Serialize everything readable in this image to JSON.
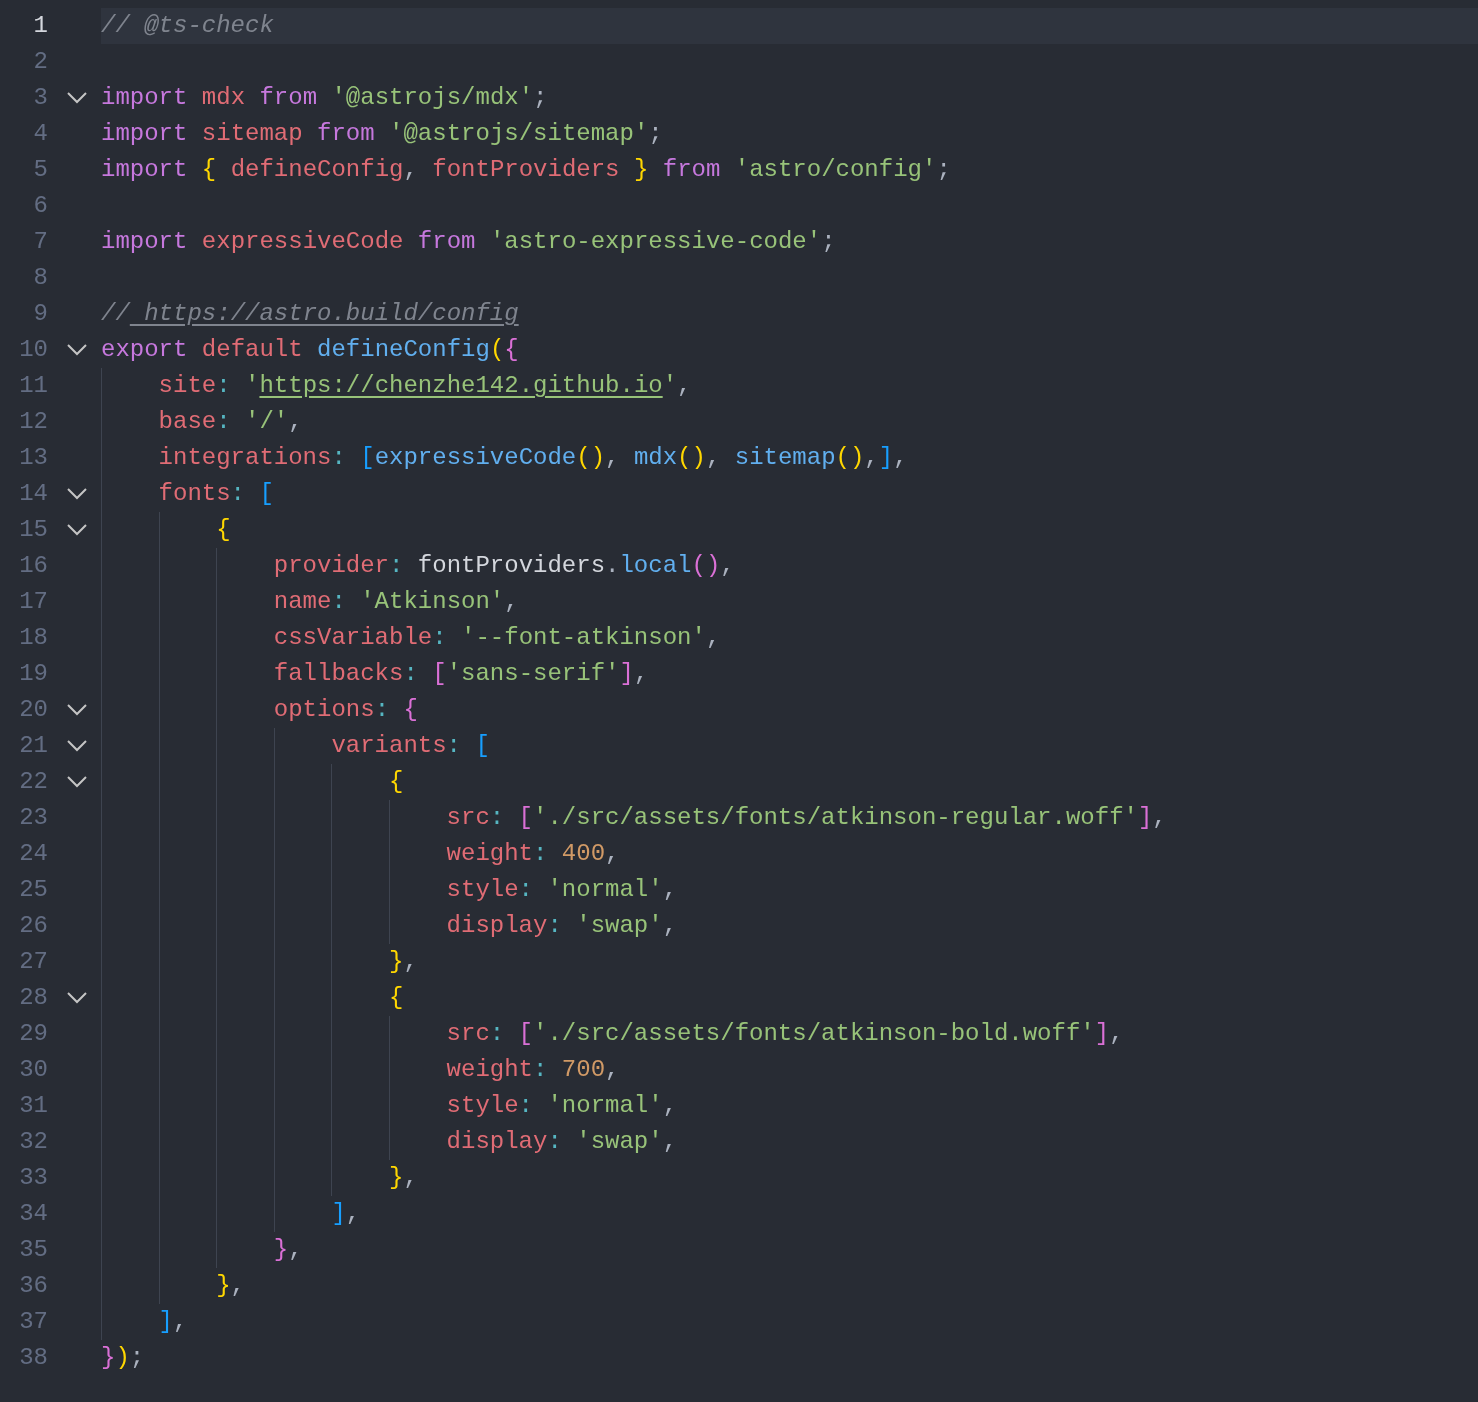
{
  "editor": {
    "lines": [
      {
        "number": "1",
        "active": true,
        "foldable": false,
        "tokens": [
          {
            "text": "// @ts-check",
            "kind": "comment"
          }
        ]
      },
      {
        "number": "2",
        "active": false,
        "foldable": false
      },
      {
        "number": "3",
        "active": false,
        "foldable": true,
        "tokens": [
          {
            "text": "import",
            "kind": "keyword"
          },
          {
            "text": " mdx",
            "kind": "variable"
          },
          {
            "text": " from",
            "kind": "keyword"
          },
          {
            "text": " '@astrojs/mdx'",
            "kind": "string"
          },
          {
            "text": ";",
            "kind": "punct"
          }
        ]
      },
      {
        "number": "4",
        "active": false,
        "foldable": false,
        "tokens": [
          {
            "text": "import",
            "kind": "keyword"
          },
          {
            "text": " sitemap",
            "kind": "variable"
          },
          {
            "text": " from",
            "kind": "keyword"
          },
          {
            "text": " '@astrojs/sitemap'",
            "kind": "string"
          },
          {
            "text": ";",
            "kind": "punct"
          }
        ]
      },
      {
        "number": "5",
        "active": false,
        "foldable": false,
        "tokens": [
          {
            "text": "import",
            "kind": "keyword"
          },
          {
            "text": " {",
            "kind": "brace1"
          },
          {
            "text": " defineConfig",
            "kind": "variable"
          },
          {
            "text": ",",
            "kind": "punct"
          },
          {
            "text": " fontProviders",
            "kind": "variable"
          },
          {
            "text": " }",
            "kind": "brace1"
          },
          {
            "text": " from",
            "kind": "keyword"
          },
          {
            "text": " 'astro/config'",
            "kind": "string"
          },
          {
            "text": ";",
            "kind": "punct"
          }
        ]
      },
      {
        "number": "6",
        "active": false,
        "foldable": false
      },
      {
        "number": "7",
        "active": false,
        "foldable": false,
        "tokens": [
          {
            "text": "import",
            "kind": "keyword"
          },
          {
            "text": " expressiveCode",
            "kind": "variable"
          },
          {
            "text": " from",
            "kind": "keyword"
          },
          {
            "text": " 'astro-expressive-code'",
            "kind": "string"
          },
          {
            "text": ";",
            "kind": "punct"
          }
        ]
      },
      {
        "number": "8",
        "active": false,
        "foldable": false
      },
      {
        "number": "9",
        "active": false,
        "foldable": false,
        "tokens": [
          {
            "text": "//",
            "kind": "comment"
          },
          {
            "text": " https://astro.build/config",
            "kind": "comment-link"
          }
        ]
      },
      {
        "number": "10",
        "active": false,
        "foldable": true,
        "tokens": [
          {
            "text": "export",
            "kind": "keyword"
          },
          {
            "text": " default",
            "kind": "variable"
          },
          {
            "text": " defineConfig",
            "kind": "function"
          },
          {
            "text": "(",
            "kind": "brace1"
          },
          {
            "text": "{",
            "kind": "brace2"
          }
        ],
        "children": [
          {
            "number": "11",
            "active": false,
            "foldable": false,
            "tokens": [
              {
                "text": "site",
                "kind": "variable"
              },
              {
                "text": ":",
                "kind": "colon"
              },
              {
                "text": " '",
                "kind": "string"
              },
              {
                "text": "https://chenzhe142.github.io",
                "kind": "string-link"
              },
              {
                "text": "'",
                "kind": "string"
              },
              {
                "text": ",",
                "kind": "punct"
              }
            ]
          },
          {
            "number": "12",
            "active": false,
            "foldable": false,
            "tokens": [
              {
                "text": "base",
                "kind": "variable"
              },
              {
                "text": ":",
                "kind": "colon"
              },
              {
                "text": " '/'",
                "kind": "string"
              },
              {
                "text": ",",
                "kind": "punct"
              }
            ]
          },
          {
            "number": "13",
            "active": false,
            "foldable": false,
            "tokens": [
              {
                "text": "integrations",
                "kind": "variable"
              },
              {
                "text": ":",
                "kind": "colon"
              },
              {
                "text": " [",
                "kind": "brace3"
              },
              {
                "text": "expressiveCode",
                "kind": "function"
              },
              {
                "text": "()",
                "kind": "brace1"
              },
              {
                "text": ",",
                "kind": "punct"
              },
              {
                "text": " mdx",
                "kind": "function"
              },
              {
                "text": "()",
                "kind": "brace1"
              },
              {
                "text": ",",
                "kind": "punct"
              },
              {
                "text": " sitemap",
                "kind": "function"
              },
              {
                "text": "()",
                "kind": "brace1"
              },
              {
                "text": ",",
                "kind": "punct"
              },
              {
                "text": "]",
                "kind": "brace3"
              },
              {
                "text": ",",
                "kind": "punct"
              }
            ]
          },
          {
            "number": "14",
            "active": false,
            "foldable": true,
            "tokens": [
              {
                "text": "fonts",
                "kind": "variable"
              },
              {
                "text": ":",
                "kind": "colon"
              },
              {
                "text": " [",
                "kind": "brace3"
              }
            ],
            "children": [
              {
                "number": "15",
                "active": false,
                "foldable": true,
                "tokens": [
                  {
                    "text": "{",
                    "kind": "brace1"
                  }
                ],
                "children": [
                  {
                    "number": "16",
                    "active": false,
                    "foldable": false,
                    "tokens": [
                      {
                        "text": "provider",
                        "kind": "variable"
                      },
                      {
                        "text": ":",
                        "kind": "colon"
                      },
                      {
                        "text": " fontProviders",
                        "kind": "plain"
                      },
                      {
                        "text": ".",
                        "kind": "punct"
                      },
                      {
                        "text": "local",
                        "kind": "function"
                      },
                      {
                        "text": "()",
                        "kind": "brace2"
                      },
                      {
                        "text": ",",
                        "kind": "punct"
                      }
                    ]
                  },
                  {
                    "number": "17",
                    "active": false,
                    "foldable": false,
                    "tokens": [
                      {
                        "text": "name",
                        "kind": "variable"
                      },
                      {
                        "text": ":",
                        "kind": "colon"
                      },
                      {
                        "text": " 'Atkinson'",
                        "kind": "string"
                      },
                      {
                        "text": ",",
                        "kind": "punct"
                      }
                    ]
                  },
                  {
                    "number": "18",
                    "active": false,
                    "foldable": false,
                    "tokens": [
                      {
                        "text": "cssVariable",
                        "kind": "variable"
                      },
                      {
                        "text": ":",
                        "kind": "colon"
                      },
                      {
                        "text": " '--font-atkinson'",
                        "kind": "string"
                      },
                      {
                        "text": ",",
                        "kind": "punct"
                      }
                    ]
                  },
                  {
                    "number": "19",
                    "active": false,
                    "foldable": false,
                    "tokens": [
                      {
                        "text": "fallbacks",
                        "kind": "variable"
                      },
                      {
                        "text": ":",
                        "kind": "colon"
                      },
                      {
                        "text": " [",
                        "kind": "brace2"
                      },
                      {
                        "text": "'sans-serif'",
                        "kind": "string"
                      },
                      {
                        "text": "]",
                        "kind": "brace2"
                      },
                      {
                        "text": ",",
                        "kind": "punct"
                      }
                    ]
                  },
                  {
                    "number": "20",
                    "active": false,
                    "foldable": true,
                    "tokens": [
                      {
                        "text": "options",
                        "kind": "variable"
                      },
                      {
                        "text": ":",
                        "kind": "colon"
                      },
                      {
                        "text": " {",
                        "kind": "brace2"
                      }
                    ],
                    "children": [
                      {
                        "number": "21",
                        "active": false,
                        "foldable": true,
                        "tokens": [
                          {
                            "text": "variants",
                            "kind": "variable"
                          },
                          {
                            "text": ":",
                            "kind": "colon"
                          },
                          {
                            "text": " [",
                            "kind": "brace3"
                          }
                        ],
                        "children": [
                          {
                            "number": "22",
                            "active": false,
                            "foldable": true,
                            "tokens": [
                              {
                                "text": "{",
                                "kind": "brace1"
                              }
                            ],
                            "children": [
                              {
                                "number": "23",
                                "active": false,
                                "foldable": false,
                                "tokens": [
                                  {
                                    "text": "src",
                                    "kind": "variable"
                                  },
                                  {
                                    "text": ":",
                                    "kind": "colon"
                                  },
                                  {
                                    "text": " [",
                                    "kind": "brace2"
                                  },
                                  {
                                    "text": "'./src/assets/fonts/atkinson-regular.woff'",
                                    "kind": "string"
                                  },
                                  {
                                    "text": "]",
                                    "kind": "brace2"
                                  },
                                  {
                                    "text": ",",
                                    "kind": "punct"
                                  }
                                ]
                              },
                              {
                                "number": "24",
                                "active": false,
                                "foldable": false,
                                "tokens": [
                                  {
                                    "text": "weight",
                                    "kind": "variable"
                                  },
                                  {
                                    "text": ":",
                                    "kind": "colon"
                                  },
                                  {
                                    "text": " 400",
                                    "kind": "number"
                                  },
                                  {
                                    "text": ",",
                                    "kind": "punct"
                                  }
                                ]
                              },
                              {
                                "number": "25",
                                "active": false,
                                "foldable": false,
                                "tokens": [
                                  {
                                    "text": "style",
                                    "kind": "variable"
                                  },
                                  {
                                    "text": ":",
                                    "kind": "colon"
                                  },
                                  {
                                    "text": " 'normal'",
                                    "kind": "string"
                                  },
                                  {
                                    "text": ",",
                                    "kind": "punct"
                                  }
                                ]
                              },
                              {
                                "number": "26",
                                "active": false,
                                "foldable": false,
                                "tokens": [
                                  {
                                    "text": "display",
                                    "kind": "variable"
                                  },
                                  {
                                    "text": ":",
                                    "kind": "colon"
                                  },
                                  {
                                    "text": " 'swap'",
                                    "kind": "string"
                                  },
                                  {
                                    "text": ",",
                                    "kind": "punct"
                                  }
                                ]
                              }
                            ]
                          },
                          {
                            "number": "27",
                            "active": false,
                            "foldable": false,
                            "tokens": [
                              {
                                "text": "}",
                                "kind": "brace1"
                              },
                              {
                                "text": ",",
                                "kind": "punct"
                              }
                            ]
                          },
                          {
                            "number": "28",
                            "active": false,
                            "foldable": true,
                            "tokens": [
                              {
                                "text": "{",
                                "kind": "brace1"
                              }
                            ],
                            "children": [
                              {
                                "number": "29",
                                "active": false,
                                "foldable": false,
                                "tokens": [
                                  {
                                    "text": "src",
                                    "kind": "variable"
                                  },
                                  {
                                    "text": ":",
                                    "kind": "colon"
                                  },
                                  {
                                    "text": " [",
                                    "kind": "brace2"
                                  },
                                  {
                                    "text": "'./src/assets/fonts/atkinson-bold.woff'",
                                    "kind": "string"
                                  },
                                  {
                                    "text": "]",
                                    "kind": "brace2"
                                  },
                                  {
                                    "text": ",",
                                    "kind": "punct"
                                  }
                                ]
                              },
                              {
                                "number": "30",
                                "active": false,
                                "foldable": false,
                                "tokens": [
                                  {
                                    "text": "weight",
                                    "kind": "variable"
                                  },
                                  {
                                    "text": ":",
                                    "kind": "colon"
                                  },
                                  {
                                    "text": " 700",
                                    "kind": "number"
                                  },
                                  {
                                    "text": ",",
                                    "kind": "punct"
                                  }
                                ]
                              },
                              {
                                "number": "31",
                                "active": false,
                                "foldable": false,
                                "tokens": [
                                  {
                                    "text": "style",
                                    "kind": "variable"
                                  },
                                  {
                                    "text": ":",
                                    "kind": "colon"
                                  },
                                  {
                                    "text": " 'normal'",
                                    "kind": "string"
                                  },
                                  {
                                    "text": ",",
                                    "kind": "punct"
                                  }
                                ]
                              },
                              {
                                "number": "32",
                                "active": false,
                                "foldable": false,
                                "tokens": [
                                  {
                                    "text": "display",
                                    "kind": "variable"
                                  },
                                  {
                                    "text": ":",
                                    "kind": "colon"
                                  },
                                  {
                                    "text": " 'swap'",
                                    "kind": "string"
                                  },
                                  {
                                    "text": ",",
                                    "kind": "punct"
                                  }
                                ]
                              }
                            ]
                          },
                          {
                            "number": "33",
                            "active": false,
                            "foldable": false,
                            "tokens": [
                              {
                                "text": "}",
                                "kind": "brace1"
                              },
                              {
                                "text": ",",
                                "kind": "punct"
                              }
                            ]
                          }
                        ]
                      },
                      {
                        "number": "34",
                        "active": false,
                        "foldable": false,
                        "tokens": [
                          {
                            "text": "]",
                            "kind": "brace3"
                          },
                          {
                            "text": ",",
                            "kind": "punct"
                          }
                        ]
                      }
                    ]
                  },
                  {
                    "number": "35",
                    "active": false,
                    "foldable": false,
                    "tokens": [
                      {
                        "text": "}",
                        "kind": "brace2"
                      },
                      {
                        "text": ",",
                        "kind": "punct"
                      }
                    ]
                  }
                ]
              },
              {
                "number": "36",
                "active": false,
                "foldable": false,
                "tokens": [
                  {
                    "text": "}",
                    "kind": "brace1"
                  },
                  {
                    "text": ",",
                    "kind": "punct"
                  }
                ]
              }
            ]
          },
          {
            "number": "37",
            "active": false,
            "foldable": false,
            "tokens": [
              {
                "text": "]",
                "kind": "brace3"
              },
              {
                "text": ",",
                "kind": "punct"
              }
            ]
          }
        ]
      },
      {
        "number": "38",
        "active": false,
        "foldable": false,
        "tokens": [
          {
            "text": "}",
            "kind": "brace2"
          },
          {
            "text": ")",
            "kind": "brace1"
          },
          {
            "text": ";",
            "kind": "punct"
          }
        ]
      }
    ]
  }
}
